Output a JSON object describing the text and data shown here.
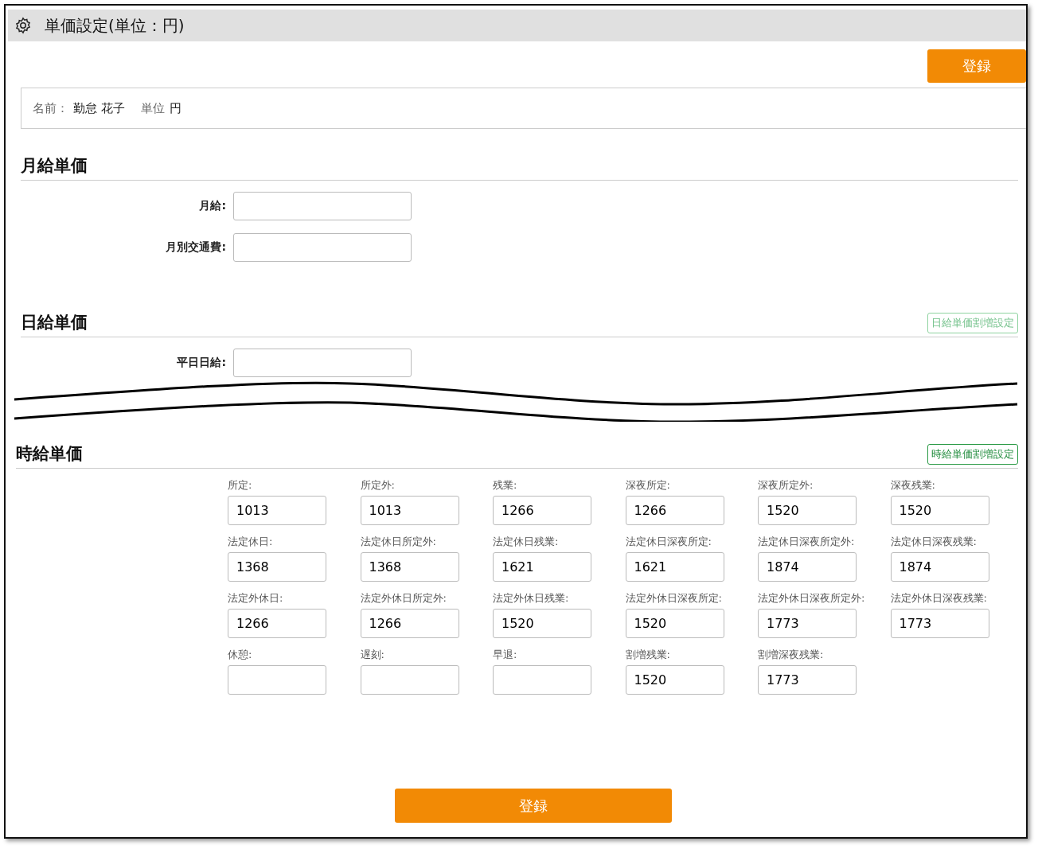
{
  "window": {
    "title": "単価設定(単位：円)"
  },
  "top_button": "登録",
  "info": {
    "name_label": "名前：",
    "name": "勤怠 花子",
    "unit_label": "単位",
    "unit": "円"
  },
  "monthly": {
    "heading": "月給単価",
    "fields": [
      {
        "label": "月給:"
      },
      {
        "label": "月別交通費:"
      }
    ]
  },
  "daily": {
    "heading": "日給単価",
    "link_button": {
      "label": "日給単価割増設定",
      "disabled": true
    },
    "fields": [
      {
        "label": "平日日給:"
      }
    ]
  },
  "hourly": {
    "heading": "時給単価",
    "link_button": {
      "label": "時給単価割増設定",
      "disabled": false
    },
    "fields": [
      {
        "label": "所定:",
        "value": "1013"
      },
      {
        "label": "所定外:",
        "value": "1013"
      },
      {
        "label": "残業:",
        "value": "1266"
      },
      {
        "label": "深夜所定:",
        "value": "1266"
      },
      {
        "label": "深夜所定外:",
        "value": "1520"
      },
      {
        "label": "深夜残業:",
        "value": "1520"
      },
      {
        "label": "法定休日:",
        "value": "1368"
      },
      {
        "label": "法定休日所定外:",
        "value": "1368"
      },
      {
        "label": "法定休日残業:",
        "value": "1621"
      },
      {
        "label": "法定休日深夜所定:",
        "value": "1621"
      },
      {
        "label": "法定休日深夜所定外:",
        "value": "1874"
      },
      {
        "label": "法定休日深夜残業:",
        "value": "1874"
      },
      {
        "label": "法定外休日:",
        "value": "1266"
      },
      {
        "label": "法定外休日所定外:",
        "value": "1266"
      },
      {
        "label": "法定外休日残業:",
        "value": "1520"
      },
      {
        "label": "法定外休日深夜所定:",
        "value": "1520"
      },
      {
        "label": "法定外休日深夜所定外:",
        "value": "1773"
      },
      {
        "label": "法定外休日深夜残業:",
        "value": "1773"
      },
      {
        "label": "休憩:"
      },
      {
        "label": "遅刻:"
      },
      {
        "label": "早退:"
      },
      {
        "label": "割増残業:",
        "value": "1520"
      },
      {
        "label": "割増深夜残業:",
        "value": "1773"
      }
    ]
  },
  "bottom_button": "登録"
}
